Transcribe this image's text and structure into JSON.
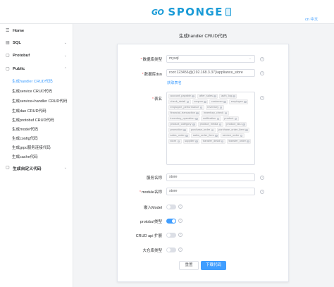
{
  "header": {
    "logo_go": "GO",
    "logo_sponge": "SPONGE",
    "language": "cn 中文"
  },
  "sidebar": {
    "home": "Home",
    "sql": "SQL",
    "protobuf": "Protobuf",
    "public": "Public",
    "public_items": [
      "生成handler CRUD代码",
      "生成service CRUD代码",
      "生成service+handler CRUD代码",
      "生成dao CRUD代码",
      "生成protobuf CRUD代码",
      "生成model代码",
      "生成config代码",
      "生成grpc服务连接代码",
      "生成cache代码"
    ],
    "custom": "生成自定义代码"
  },
  "form": {
    "title": "生成handler CRUD代码",
    "db_type_label": "数据库类型",
    "db_type_value": "mysql",
    "dsn_label": "数据库dsn",
    "dsn_value": "root:123456@(192.168.3.37)/appliance_store",
    "fetch_tables_link": "获取表名",
    "tables_label": "表名",
    "tables": [
      "account_payable",
      "after_sales",
      "auth_log",
      "check_detail",
      "coupon",
      "customer",
      "employee",
      "employee_performance",
      "inventory",
      "financial_transaction",
      "inventory_check",
      "inventory_operation",
      "notification",
      "product",
      "product_category",
      "product_media",
      "product_sku",
      "promotion",
      "purchase_order",
      "purchase_order_item",
      "sales_order",
      "sales_order_item",
      "service_order",
      "store",
      "supplier",
      "transfer_detail",
      "transfer_order"
    ],
    "service_name_label": "服务名称",
    "service_name_value": "store",
    "module_name_label": "module名称",
    "module_name_value": "store",
    "embed_model_label": "嵌入Model",
    "protobuf_type_label": "protobuf类型",
    "crud_api_ext_label": "CRUD api 扩展",
    "large_repo_label": "大仓库类型",
    "switches": {
      "embed_model": false,
      "protobuf_type": true,
      "crud_api_ext": false,
      "large_repo": false
    },
    "reset_button": "重置",
    "download_button": "下载代码"
  }
}
